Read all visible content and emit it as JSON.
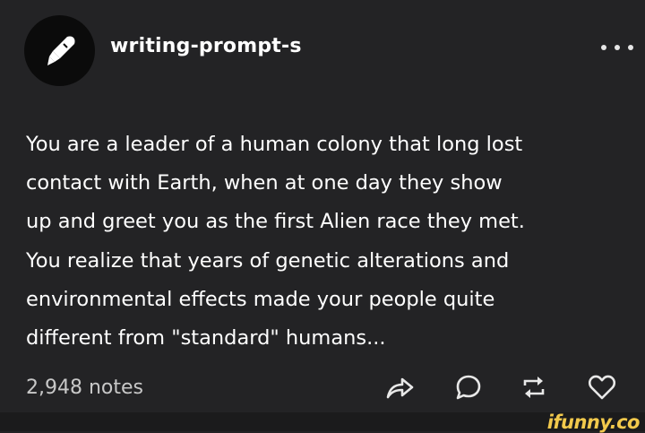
{
  "post": {
    "username": "writing-prompt-s",
    "avatar_icon": "quill-pen-icon",
    "more_icon": "more-options-icon",
    "text_lines": [
      "You are a leader of a human colony that long lost",
      "contact with Earth, when at one day they show",
      "up and greet you as the first Alien race they met.",
      "You realize that years of genetic alterations and",
      "environmental effects made your people quite",
      "different from \"standard\" humans..."
    ],
    "notes": "2,948 notes",
    "actions": [
      "share-icon",
      "reply-icon",
      "reblog-icon",
      "like-icon"
    ]
  },
  "watermark": {
    "text": "ifunny.co",
    "color": "#f2c94c"
  }
}
